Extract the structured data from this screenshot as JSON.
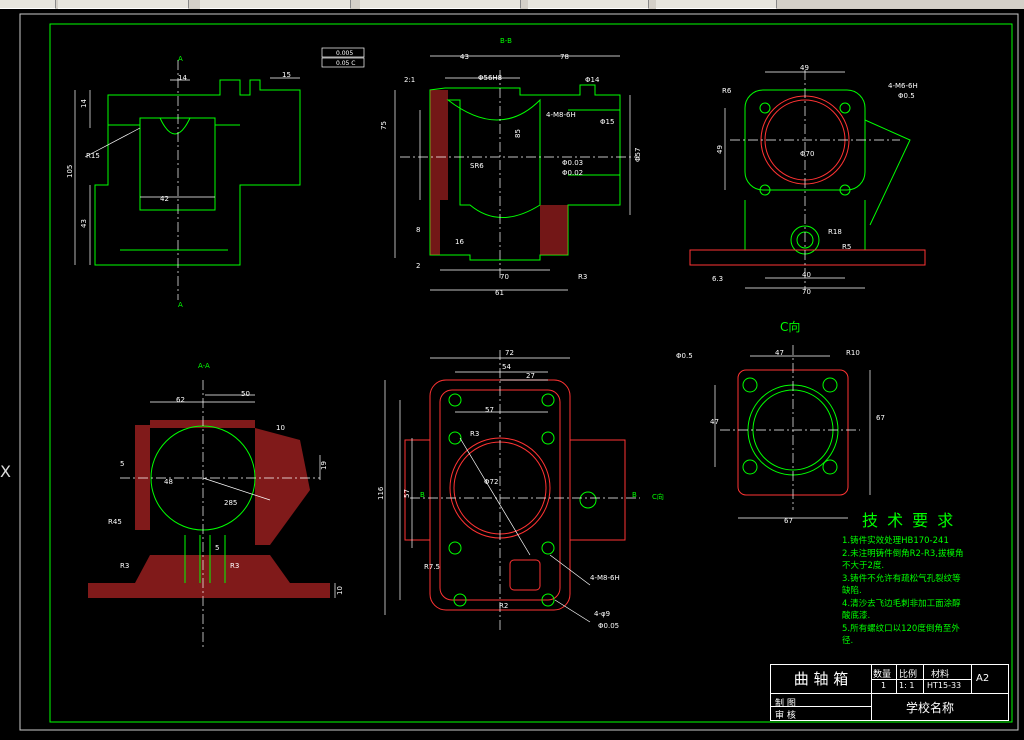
{
  "window": {
    "tabs": [
      "",
      "",
      "",
      "",
      "",
      ""
    ]
  },
  "views": {
    "bb_label": "B-B",
    "aa_label": "A-A",
    "c_view_label": "C向",
    "cut_a": "A",
    "cut_b": "B",
    "cut_c": "C向"
  },
  "dimensions": {
    "v1": [
      "14",
      "15",
      "14",
      "R15",
      "105",
      "43",
      "42",
      "A",
      "A"
    ],
    "v2": [
      "43",
      "78",
      "Φ56H8",
      "Φ14",
      "2:1",
      "4-M8-6H",
      "Φ15",
      "85",
      "SR6",
      "Φ0.03",
      "Φ0.02",
      "75",
      "70",
      "61",
      "16",
      "8",
      "2",
      "R3",
      "Φ57"
    ],
    "v3": [
      "49",
      "R6",
      "4-M6-6H",
      "Φ0.5",
      "Φ70",
      "49",
      "R18",
      "R5",
      "40",
      "70",
      "6.3"
    ],
    "v4": [
      "62",
      "50",
      "10",
      "5",
      "19",
      "48",
      "R45",
      "5",
      "R3",
      "R3",
      "10",
      "285"
    ],
    "v5": [
      "72",
      "54",
      "27",
      "57",
      "R3",
      "Φ72",
      "116",
      "57",
      "R7.5",
      "4-M8-6H",
      "4-φ9",
      "R2",
      "Φ0.05"
    ],
    "v6": [
      "47",
      "R10",
      "47",
      "67",
      "67",
      "Φ0.5"
    ],
    "tolerance_boxes": [
      "0.005",
      "0.05 C"
    ]
  },
  "tech_req": {
    "title": "技 术 要 求",
    "items": [
      "1.铸件实效处理HB170-241",
      "2.未注明铸件倒角R2-R3,拔模角",
      "不大于2度.",
      "3.铸件不允许有疏松气孔裂纹等",
      "缺陷.",
      "4.清沙去飞边毛刺非加工面涂醇",
      "酸底漆.",
      "5.所有螺纹口以120度倒角至外",
      "径."
    ]
  },
  "title_block": {
    "part_name": "曲 轴 箱",
    "qty_label": "数量",
    "scale_label": "比例",
    "material_label": "材料",
    "qty": "1",
    "scale": "1: 1",
    "material": "HT15-33",
    "sheet": "A2",
    "drawn_label": "制 图",
    "checked_label": "审 核",
    "school": "学校名称"
  },
  "side_marker": "X",
  "colors": {
    "outline": "#00ff00",
    "cut": "#ff3333",
    "dim": "#ffffff",
    "center": "#ffffff",
    "hatch": "#ff4444",
    "text_green": "#00ff00",
    "frame": "#ffffff"
  }
}
